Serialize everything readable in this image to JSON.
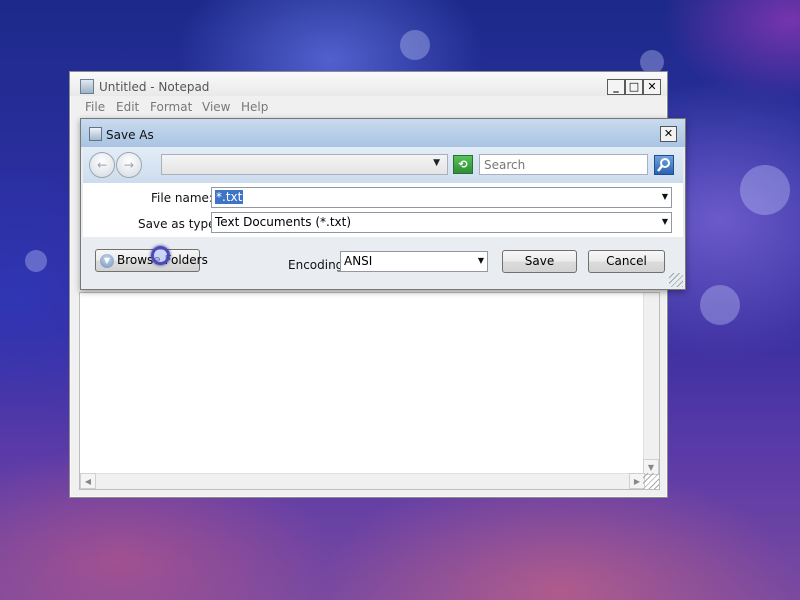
{
  "notepad": {
    "title": "Untitled - Notepad",
    "menu": [
      "File",
      "Edit",
      "Format",
      "View",
      "Help"
    ],
    "caption_buttons": {
      "minimize": "_",
      "maximize": "□",
      "close": "✕"
    }
  },
  "dialog": {
    "title": "Save As",
    "close_glyph": "✕",
    "nav": {
      "back_glyph": "←",
      "forward_glyph": "→",
      "refresh_glyph": "⟲",
      "dropdown_glyph": "▼"
    },
    "search": {
      "placeholder": "Search"
    },
    "file_name": {
      "label": "File name:",
      "value": "*.txt"
    },
    "save_as_type": {
      "label": "Save as type:",
      "value": "Text Documents (*.txt)"
    },
    "browse_folders": {
      "label": "Browse Folders",
      "icon": "chevron-down-icon"
    },
    "encoding": {
      "label": "Encoding:",
      "value": "ANSI"
    },
    "save_label": "Save",
    "cancel_label": "Cancel"
  },
  "colors": {
    "selection": "#3d74c8",
    "dialog_titlebar": "#a9c3e2"
  },
  "icons": {
    "refresh": "refresh-icon",
    "search": "search-icon",
    "busy_cursor": "busy-cursor-icon"
  }
}
